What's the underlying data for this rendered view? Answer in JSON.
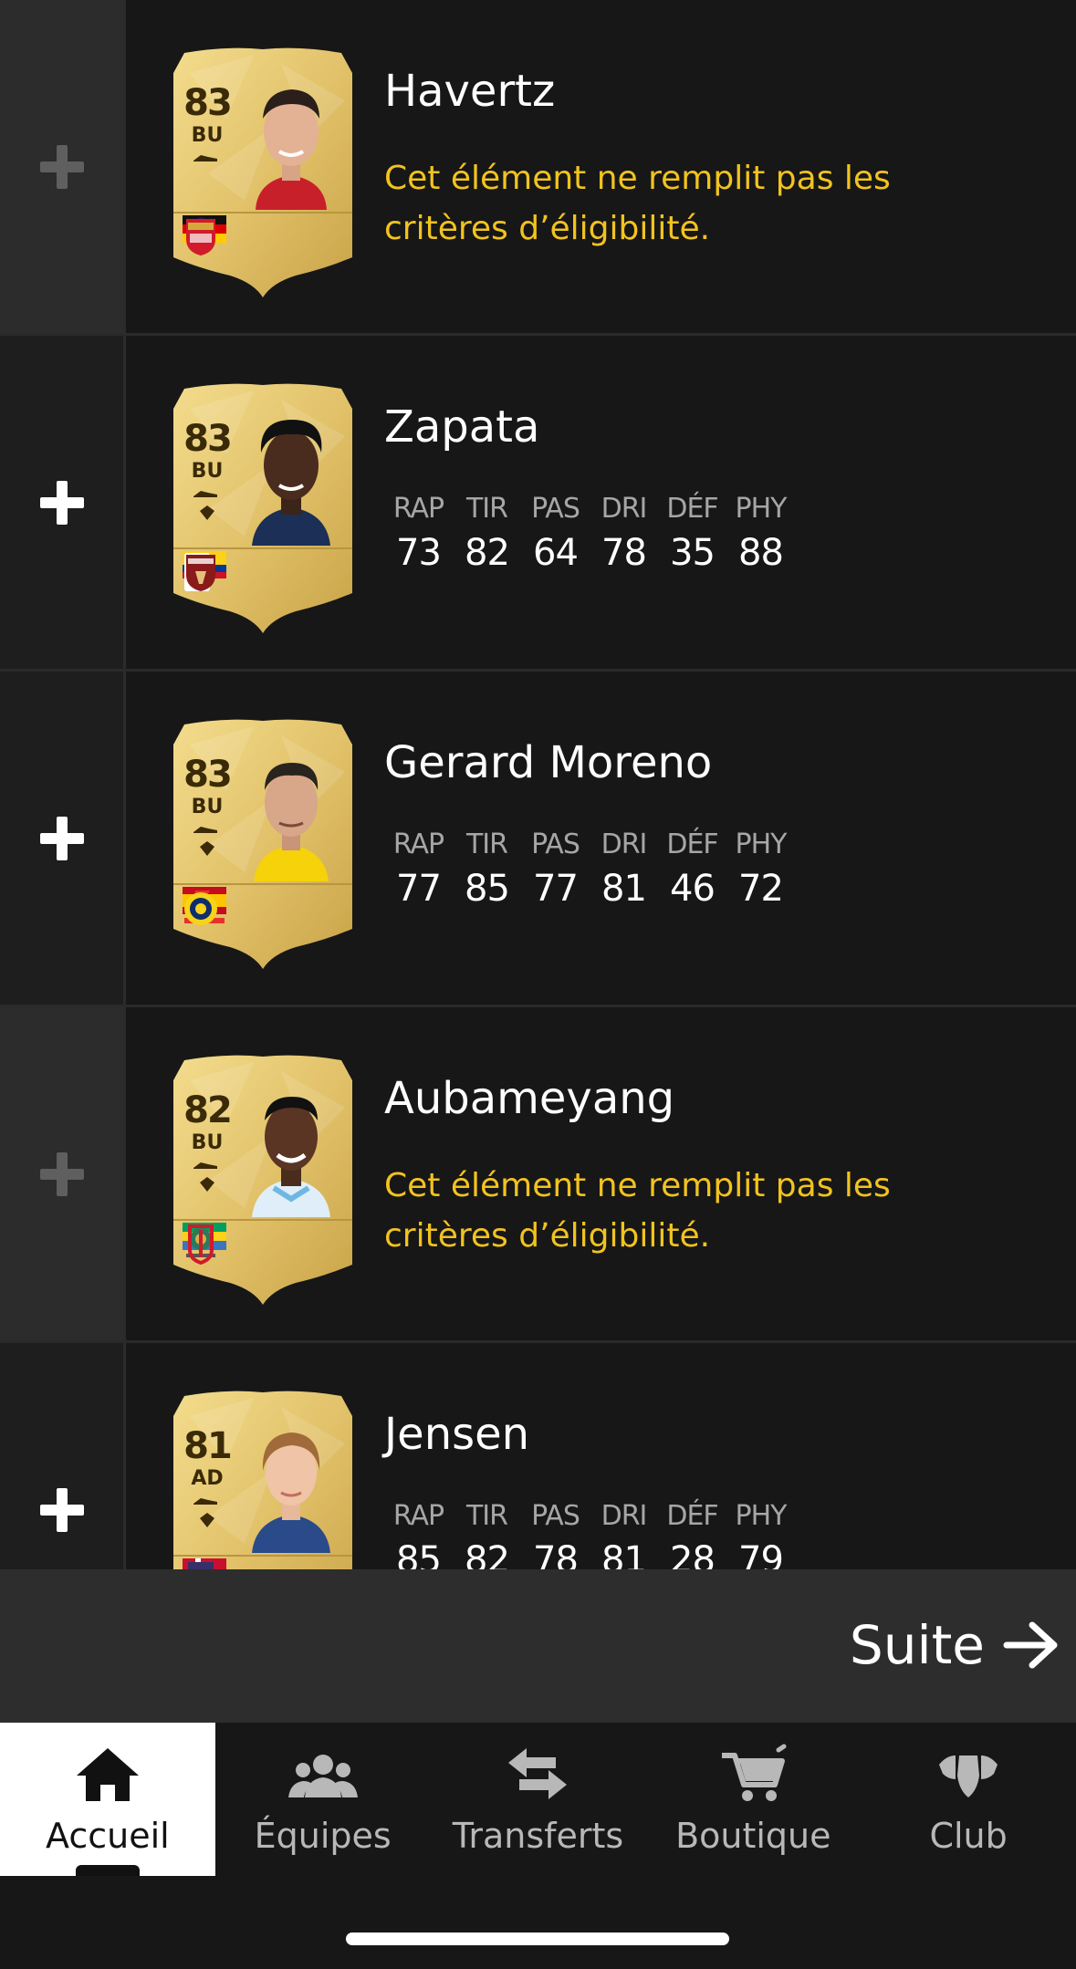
{
  "players": [
    {
      "name": "Havertz",
      "rating": "83",
      "position": "BU",
      "eligible": false,
      "warning": "Cet élément ne remplit pas les critères d’éligibilité.",
      "flag": "germany-flag-icon",
      "league": "premier-league-icon",
      "club": "arsenal-crest-icon"
    },
    {
      "name": "Zapata",
      "rating": "83",
      "position": "BU",
      "eligible": true,
      "stats": [
        {
          "label": "RAP",
          "value": "73"
        },
        {
          "label": "TIR",
          "value": "82"
        },
        {
          "label": "PAS",
          "value": "64"
        },
        {
          "label": "DRI",
          "value": "78"
        },
        {
          "label": "DÉF",
          "value": "35"
        },
        {
          "label": "PHY",
          "value": "88"
        }
      ],
      "flag": "colombia-flag-icon",
      "league": "serie-a-icon",
      "club": "torino-crest-icon"
    },
    {
      "name": "Gerard Moreno",
      "rating": "83",
      "position": "BU",
      "eligible": true,
      "stats": [
        {
          "label": "RAP",
          "value": "77"
        },
        {
          "label": "TIR",
          "value": "85"
        },
        {
          "label": "PAS",
          "value": "77"
        },
        {
          "label": "DRI",
          "value": "81"
        },
        {
          "label": "DÉF",
          "value": "46"
        },
        {
          "label": "PHY",
          "value": "72"
        }
      ],
      "flag": "spain-flag-icon",
      "league": "laliga-icon",
      "club": "villarreal-crest-icon"
    },
    {
      "name": "Aubameyang",
      "rating": "82",
      "position": "BU",
      "eligible": false,
      "warning": "Cet élément ne remplit pas les critères d’éligibilité.",
      "flag": "gabon-flag-icon",
      "league": "roshn-saudi-league-icon",
      "club": "al-qadsiah-crest-icon"
    },
    {
      "name": "Jensen",
      "rating": "81",
      "position": "AD",
      "eligible": true,
      "stats": [
        {
          "label": "RAP",
          "value": "85"
        },
        {
          "label": "TIR",
          "value": "82"
        },
        {
          "label": "PAS",
          "value": "78"
        },
        {
          "label": "DRI",
          "value": "81"
        },
        {
          "label": "DÉF",
          "value": "28"
        },
        {
          "label": "PHY",
          "value": "79"
        }
      ],
      "flag": "flag-icon",
      "league": "league-icon",
      "club": "club-crest-icon"
    }
  ],
  "footer": {
    "next_label": "Suite"
  },
  "tabs": [
    {
      "label": "Accueil",
      "icon": "home-icon",
      "active": true
    },
    {
      "label": "Équipes",
      "icon": "squad-icon",
      "active": false
    },
    {
      "label": "Transferts",
      "icon": "transfer-arrows-icon",
      "active": false
    },
    {
      "label": "Boutique",
      "icon": "cart-icon",
      "active": false
    },
    {
      "label": "Club",
      "icon": "club-shield-icon",
      "active": false
    }
  ],
  "colors": {
    "background": "#171717",
    "warning": "#f2c31f",
    "card_gold": "#e2c26a",
    "footer_bar": "#2d2d2d"
  }
}
